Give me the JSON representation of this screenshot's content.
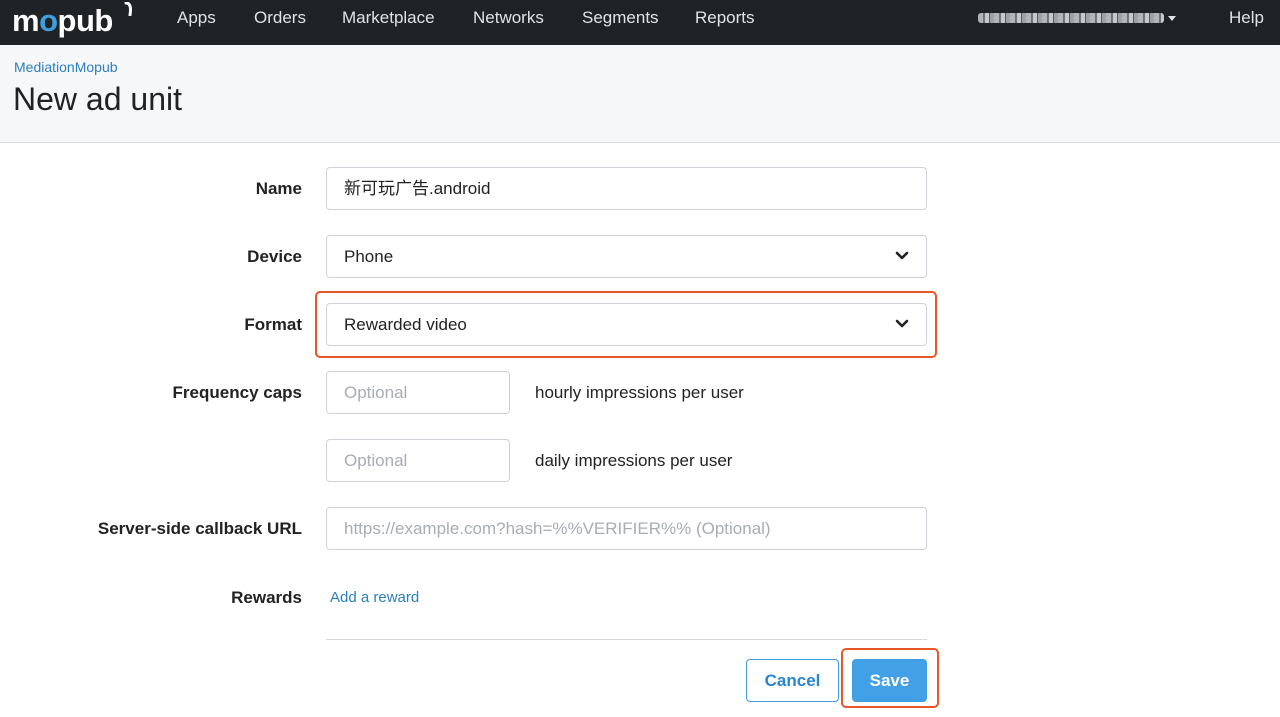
{
  "nav": {
    "logo_parts": [
      "m",
      "o",
      "pub"
    ],
    "items": [
      "Apps",
      "Orders",
      "Marketplace",
      "Networks",
      "Segments",
      "Reports"
    ],
    "account_label": "",
    "help": "Help"
  },
  "header": {
    "breadcrumb": "MediationMopub",
    "title": "New ad unit"
  },
  "form": {
    "name": {
      "label": "Name",
      "value": "新可玩广告.android"
    },
    "device": {
      "label": "Device",
      "value": "Phone"
    },
    "format": {
      "label": "Format",
      "value": "Rewarded video"
    },
    "frequency_caps": {
      "label": "Frequency caps",
      "hourly_placeholder": "Optional",
      "hourly_helper": "hourly impressions per user",
      "daily_placeholder": "Optional",
      "daily_helper": "daily impressions per user"
    },
    "callback_url": {
      "label": "Server-side callback URL",
      "placeholder": "https://example.com?hash=%%VERIFIER%% (Optional)"
    },
    "rewards": {
      "label": "Rewards",
      "link": "Add a reward"
    }
  },
  "actions": {
    "cancel": "Cancel",
    "save": "Save"
  },
  "colors": {
    "nav_bg": "#1f2326",
    "accent": "#41a0e6",
    "highlight": "#e8562a",
    "link": "#2a7fc0"
  }
}
